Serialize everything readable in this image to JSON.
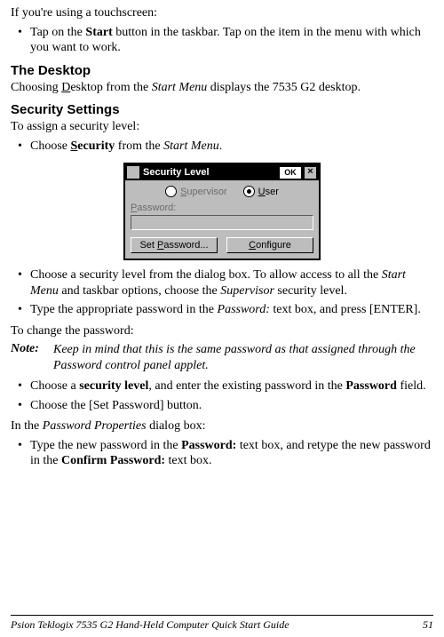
{
  "intro": {
    "touchscreen_prefix": "If you're using a touchscreen:",
    "bullet1_pre": "Tap on the ",
    "bullet1_bold": "Start",
    "bullet1_post": " button in the taskbar. Tap on the item in the menu with which you want to work."
  },
  "desktop": {
    "heading": "The Desktop",
    "line_pre": "Choosing ",
    "line_access": "D",
    "line_mid1": "esktop from the ",
    "line_ital": "Start Menu",
    "line_post": " displays the 7535 G2 desktop."
  },
  "security": {
    "heading": "Security Settings",
    "assign_intro": "To assign a security level:",
    "choose_pre": "Choose ",
    "choose_access": "S",
    "choose_word_rest": "ecurity",
    "choose_post_pre": " from the ",
    "choose_post_ital": "Start Menu",
    "choose_post_end": ".",
    "b2_pre": "Choose a security level from the dialog box. To allow access to all the ",
    "b2_ital1": "Start Menu",
    "b2_mid": " and taskbar options, choose the ",
    "b2_ital2": "Supervisor",
    "b2_end": " security level.",
    "b3_pre": "Type the appropriate password in the ",
    "b3_ital": "Password:",
    "b3_end": " text box, and press [ENTER].",
    "change_intro": "To change the password:",
    "note_label": "Note:",
    "note_text": "Keep in mind that this is the same password as that assigned through the Password control panel applet.",
    "c1_pre": "Choose a ",
    "c1_bold1": "security level",
    "c1_mid": ", and enter the existing password in the ",
    "c1_bold2": "Password",
    "c1_end": " field.",
    "c2": "Choose the [Set Password] button.",
    "props_intro_pre": "In the ",
    "props_intro_ital": "Password Properties",
    "props_intro_end": " dialog box:",
    "p1_pre": "Type the new password in the ",
    "p1_bold1": "Password:",
    "p1_mid": " text box, and retype the new password in the ",
    "p1_bold2": "Confirm Password:",
    "p1_end": " text box."
  },
  "dialog": {
    "title": "Security Level",
    "ok": "OK",
    "close": "×",
    "radio_supervisor_access": "S",
    "radio_supervisor_rest": "upervisor",
    "radio_user_access": "U",
    "radio_user_rest": "ser",
    "password_label_access": "P",
    "password_label_rest": "assword:",
    "btn_set_pre": "Set ",
    "btn_set_access": "P",
    "btn_set_rest": "assword...",
    "btn_conf_access": "C",
    "btn_conf_rest": "onfigure",
    "selected": "user"
  },
  "footer": {
    "title": "Psion Teklogix 7535 G2 Hand-Held Computer Quick Start Guide",
    "page": "51"
  }
}
